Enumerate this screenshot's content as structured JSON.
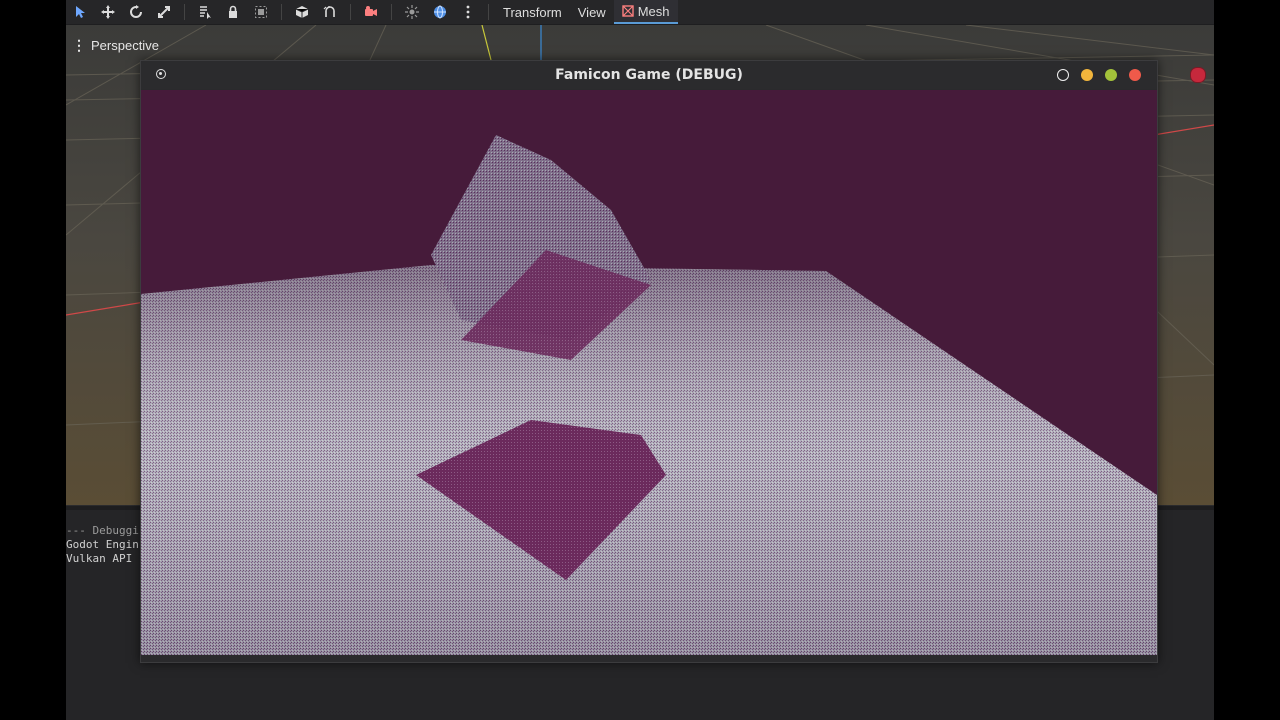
{
  "toolbar": {
    "icons": [
      "select-icon",
      "move-icon",
      "rotate-icon",
      "scale-icon",
      "list-select-icon",
      "lock-icon",
      "group-icon",
      "cube-icon",
      "snap-icon",
      "camera-icon",
      "sun-icon",
      "globe-icon",
      "more-icon"
    ],
    "menus": [
      "Transform",
      "View",
      "Mesh"
    ],
    "active_menu": "Mesh"
  },
  "viewport": {
    "mode_label": "Perspective"
  },
  "output_log": {
    "lines": [
      "--- Debuggi",
      "Godot Engin",
      "Vulkan API "
    ]
  },
  "game_window": {
    "title": "Famicon Game (DEBUG)",
    "sky_color": "#461b3a",
    "floor_color": "#b9b9c2",
    "shadow_color": "#6b2a5c"
  }
}
